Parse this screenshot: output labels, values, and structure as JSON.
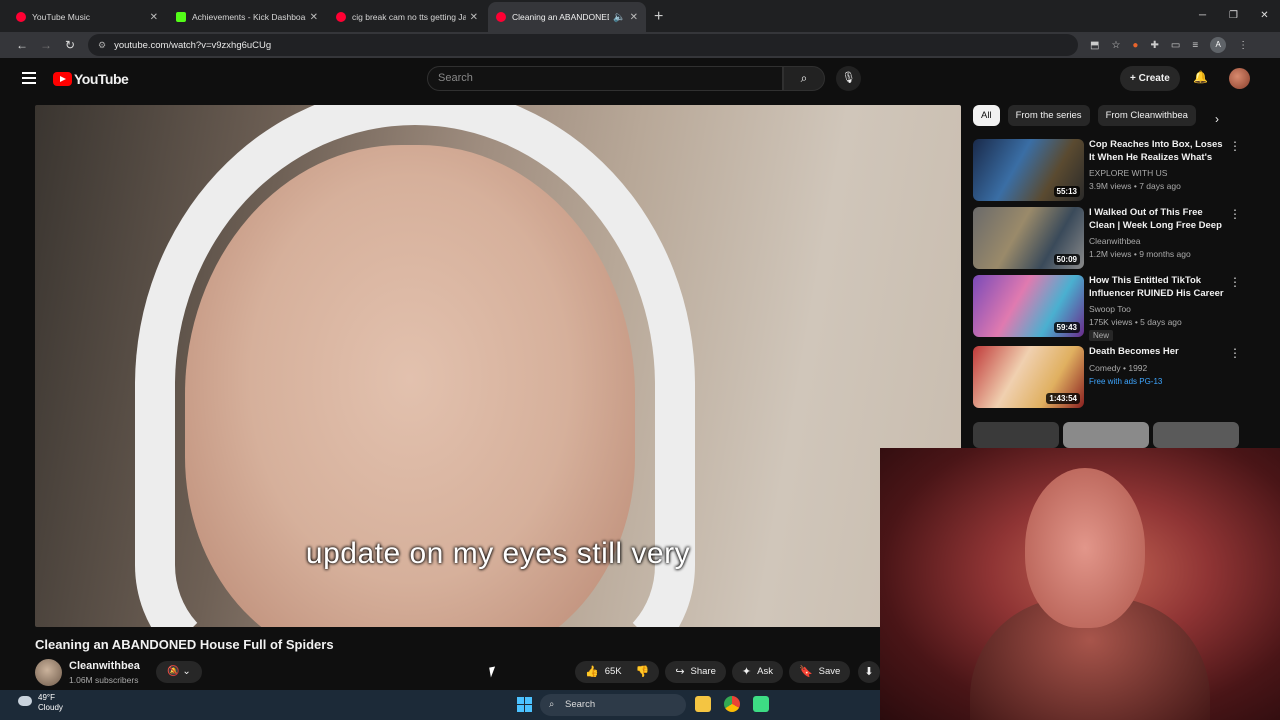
{
  "browser": {
    "tabs": [
      {
        "label": "YouTube Music",
        "color": "#ff0033",
        "active": false
      },
      {
        "label": "Achievements - Kick Dashboard",
        "color": "#53fc18",
        "active": false
      },
      {
        "label": "cig break cam no tts getting Ja",
        "color": "#ff0033",
        "active": false
      },
      {
        "label": "Cleaning an ABANDONED",
        "color": "#ff0033",
        "active": true
      }
    ],
    "url": "youtube.com/watch?v=v9zxhg6uCUg",
    "profile_initial": "A"
  },
  "youtube": {
    "logo_text": "YouTube",
    "search_placeholder": "Search",
    "create_label": "Create"
  },
  "video": {
    "caption": "update on my eyes still very",
    "title": "Cleaning an ABANDONED House Full of Spiders",
    "channel": "Cleanwithbea",
    "subscribers": "1.06M subscribers",
    "likes": "65K",
    "share_label": "Share",
    "ask_label": "Ask",
    "save_label": "Save"
  },
  "sidebar": {
    "chips": [
      "All",
      "From the series",
      "From Cleanwithbea"
    ],
    "recommendations": [
      {
        "title": "Cop Reaches Into Box, Loses It When He Realizes What's Inside",
        "channel": "EXPLORE WITH US",
        "meta": "3.9M views • 7 days ago",
        "duration": "55:13",
        "badge": "",
        "free": ""
      },
      {
        "title": "I Walked Out of This Free Clean | Week Long Free Deep Clean",
        "channel": "Cleanwithbea",
        "meta": "1.2M views • 9 months ago",
        "duration": "50:09",
        "badge": "",
        "free": ""
      },
      {
        "title": "How This Entitled TikTok Influencer RUINED His Career i...",
        "channel": "Swoop Too",
        "meta": "175K views • 5 days ago",
        "duration": "59:43",
        "badge": "New",
        "free": ""
      },
      {
        "title": "Death Becomes Her",
        "channel": "Comedy • 1992",
        "meta": "",
        "duration": "1:43:54",
        "badge": "",
        "free": "Free with ads  PG-13"
      }
    ]
  },
  "taskbar": {
    "temperature": "49°F",
    "condition": "Cloudy",
    "search_label": "Search"
  }
}
